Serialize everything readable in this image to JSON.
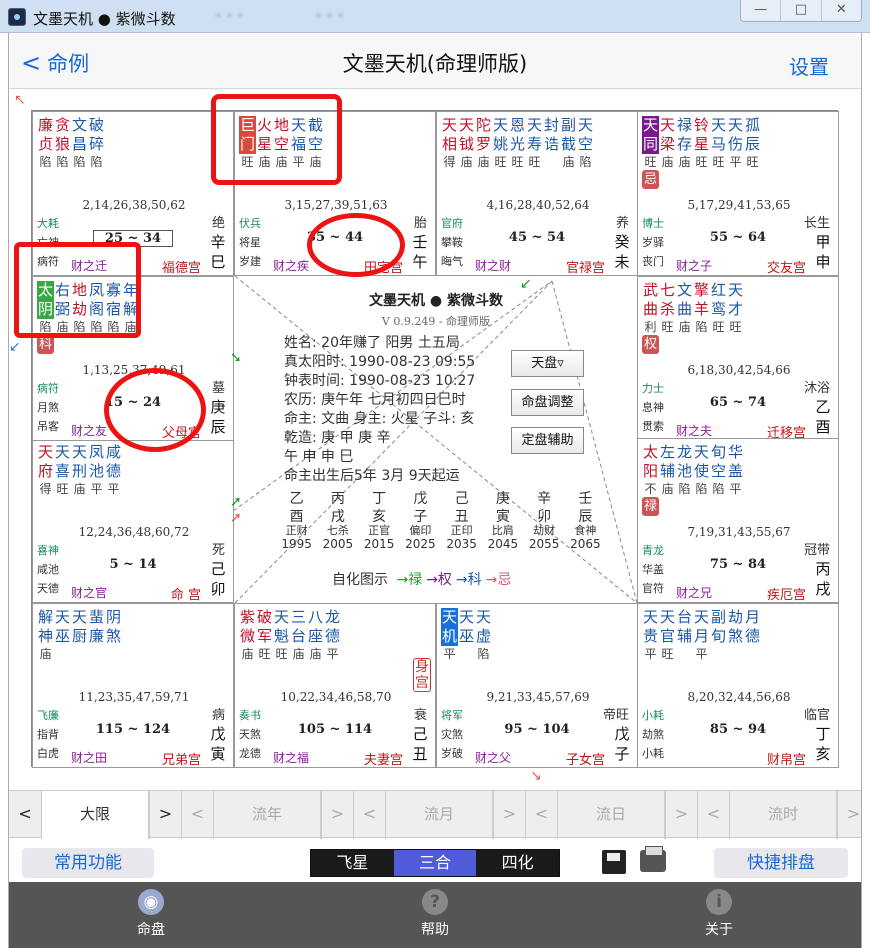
{
  "window": {
    "title": "文墨天机 ● 紫微斗数",
    "blur1": "• • •",
    "blur2": "• • •",
    "controls": [
      "—",
      "□",
      "✕"
    ]
  },
  "nav": {
    "back_label": "命例",
    "title": "文墨天机(命理师版)",
    "settings_label": "设置"
  },
  "palaces": [
    {
      "stars": [
        {
          "n": "廉贞",
          "b": "陷",
          "t": "main"
        },
        {
          "n": "贪狼",
          "b": "陷",
          "t": "main"
        },
        {
          "n": "文昌",
          "b": "陷",
          "t": "aux"
        },
        {
          "n": "破碎",
          "b": "陷",
          "t": "minor"
        }
      ],
      "ages": "2,14,26,38,50,62",
      "life": "绝",
      "range": "25 ~ 34",
      "boxed": true,
      "gz": [
        "辛",
        "巳"
      ],
      "g1": "大耗",
      "g2": "亡神",
      "g3": "病符",
      "cai": "财之迁",
      "gong": "福德宫"
    },
    {
      "stars": [
        {
          "n": "巨门",
          "b": "旺",
          "t": "chip",
          "bg": "#d94a3c"
        },
        {
          "n": "火星",
          "b": "庙",
          "t": "main"
        },
        {
          "n": "地空",
          "b": "庙",
          "t": "main"
        },
        {
          "n": "天福",
          "b": "平",
          "t": "aux"
        },
        {
          "n": "截空",
          "b": "庙",
          "t": "minor"
        }
      ],
      "ages": "3,15,27,39,51,63",
      "life": "胎",
      "range": "35 ~ 44",
      "gz": [
        "壬",
        "午"
      ],
      "g1": "伏兵",
      "g2": "将星",
      "g3": "岁建",
      "cai": "财之疾",
      "gong": "田宅宫"
    },
    {
      "stars": [
        {
          "n": "天相",
          "b": "得",
          "t": "main"
        },
        {
          "n": "天钺",
          "b": "庙",
          "t": "main"
        },
        {
          "n": "陀罗",
          "b": "庙",
          "t": "main"
        },
        {
          "n": "天姚",
          "b": "旺",
          "t": "aux"
        },
        {
          "n": "恩光",
          "b": "旺",
          "t": "aux"
        },
        {
          "n": "天寿",
          "b": "旺",
          "t": "minor"
        },
        {
          "n": "封诰",
          "b": "",
          "t": "minor"
        },
        {
          "n": "副截",
          "b": "庙",
          "t": "minor"
        },
        {
          "n": "天空",
          "b": "陷",
          "t": "minor"
        }
      ],
      "ages": "4,16,28,40,52,64",
      "life": "养",
      "range": "45 ~ 54",
      "gz": [
        "癸",
        "未"
      ],
      "g1": "官府",
      "g2": "攀鞍",
      "g3": "晦气",
      "cai": "财之财",
      "gong": "官禄宫"
    },
    {
      "stars": [
        {
          "n": "天同",
          "b": "旺",
          "t": "chip",
          "bg": "#7a1b8c"
        },
        {
          "n": "天梁",
          "b": "庙",
          "t": "main"
        },
        {
          "n": "禄存",
          "b": "庙",
          "t": "aux"
        },
        {
          "n": "铃星",
          "b": "旺",
          "t": "main"
        },
        {
          "n": "天马",
          "b": "旺",
          "t": "aux"
        },
        {
          "n": "天伤",
          "b": "平",
          "t": "minor"
        },
        {
          "n": "孤辰",
          "b": "旺",
          "t": "minor"
        }
      ],
      "hua": "忌",
      "ages": "5,17,29,41,53,65",
      "life": "长生",
      "range": "55 ~ 64",
      "gz": [
        "甲",
        "申"
      ],
      "g1": "博士",
      "g2": "岁驿",
      "g3": "丧门",
      "cai": "财之子",
      "gong": "交友宫"
    },
    {
      "stars": [
        {
          "n": "武曲",
          "b": "利",
          "t": "main"
        },
        {
          "n": "七杀",
          "b": "旺",
          "t": "main"
        },
        {
          "n": "文曲",
          "b": "庙",
          "t": "aux"
        },
        {
          "n": "擎羊",
          "b": "陷",
          "t": "main"
        },
        {
          "n": "红鸾",
          "b": "旺",
          "t": "aux"
        },
        {
          "n": "天才",
          "b": "旺",
          "t": "minor"
        }
      ],
      "hua": "权",
      "ages": "6,18,30,42,54,66",
      "life": "沐浴",
      "range": "65 ~ 74",
      "gz": [
        "乙",
        "酉"
      ],
      "g1": "力士",
      "g2": "息神",
      "g3": "贯索",
      "cai": "财之夫",
      "gong": "迁移宫"
    },
    {
      "stars": [
        {
          "n": "太阳",
          "b": "不",
          "t": "main"
        },
        {
          "n": "左辅",
          "b": "庙",
          "t": "aux"
        },
        {
          "n": "龙池",
          "b": "陷",
          "t": "minor"
        },
        {
          "n": "天使",
          "b": "陷",
          "t": "minor"
        },
        {
          "n": "旬空",
          "b": "陷",
          "t": "minor"
        },
        {
          "n": "华盖",
          "b": "平",
          "t": "minor"
        }
      ],
      "hua": "禄",
      "ages": "7,19,31,43,55,67",
      "life": "冠带",
      "range": "75 ~ 84",
      "gz": [
        "丙",
        "戌"
      ],
      "g1": "青龙",
      "g2": "华盖",
      "g3": "官符",
      "cai": "财之兄",
      "gong": "疾厄宫"
    },
    {
      "stars": [
        {
          "n": "天机",
          "b": "平",
          "t": "chip",
          "bg": "#1b6fd8"
        },
        {
          "n": "天巫",
          "b": "",
          "t": "minor"
        },
        {
          "n": "天虚",
          "b": "陷",
          "t": "minor"
        }
      ],
      "ages": "9,21,33,45,57,69",
      "life": "帝旺",
      "range": "95 ~ 104",
      "gz": [
        "戊",
        "子"
      ],
      "g1": "将军",
      "g2": "灾煞",
      "g3": "岁破",
      "cai": "财之父",
      "gong": "子女宫"
    },
    {
      "stars": [
        {
          "n": "天贵",
          "b": "平",
          "t": "minor"
        },
        {
          "n": "天官",
          "b": "旺",
          "t": "minor"
        },
        {
          "n": "台辅",
          "b": "",
          "t": "minor"
        },
        {
          "n": "天月",
          "b": "平",
          "t": "minor"
        },
        {
          "n": "副旬",
          "b": "",
          "t": "minor"
        },
        {
          "n": "劫煞",
          "b": "",
          "t": "minor"
        },
        {
          "n": "月德",
          "b": "",
          "t": "minor"
        }
      ],
      "ages": "8,20,32,44,56,68",
      "life": "临官",
      "range": "85 ~ 94",
      "gz": [
        "丁",
        "亥"
      ],
      "g1": "小耗",
      "g2": "劫煞",
      "g3": "小耗",
      "cai": "",
      "gong": "财帛宫"
    },
    {
      "stars": [
        {
          "n": "紫微",
          "b": "庙",
          "t": "main"
        },
        {
          "n": "破军",
          "b": "旺",
          "t": "main"
        },
        {
          "n": "天魁",
          "b": "旺",
          "t": "aux"
        },
        {
          "n": "三台",
          "b": "庙",
          "t": "minor"
        },
        {
          "n": "八座",
          "b": "庙",
          "t": "minor"
        },
        {
          "n": "龙德",
          "b": "平",
          "t": "minor"
        }
      ],
      "badge": "身宫",
      "ages": "10,22,34,46,58,70",
      "life": "衰",
      "range": "105 ~ 114",
      "gz": [
        "己",
        "丑"
      ],
      "g1": "奏书",
      "g2": "天煞",
      "g3": "龙德",
      "cai": "财之福",
      "gong": "夫妻宫"
    },
    {
      "stars": [
        {
          "n": "解神",
          "b": "庙",
          "t": "minor"
        },
        {
          "n": "天巫",
          "b": "",
          "t": "minor"
        },
        {
          "n": "天厨",
          "b": "",
          "t": "minor"
        },
        {
          "n": "蜚廉",
          "b": "",
          "t": "minor"
        },
        {
          "n": "阴煞",
          "b": "",
          "t": "minor"
        }
      ],
      "ages": "11,23,35,47,59,71",
      "life": "病",
      "range": "115 ~ 124",
      "gz": [
        "戊",
        "寅"
      ],
      "g1": "飞廉",
      "g2": "指背",
      "g3": "白虎",
      "cai": "财之田",
      "gong": "兄弟宫"
    },
    {
      "stars": [
        {
          "n": "天府",
          "b": "得",
          "t": "main"
        },
        {
          "n": "天喜",
          "b": "旺",
          "t": "aux"
        },
        {
          "n": "天刑",
          "b": "庙",
          "t": "minor"
        },
        {
          "n": "凤池",
          "b": "平",
          "t": "minor"
        },
        {
          "n": "咸德",
          "b": "平",
          "t": "minor"
        }
      ],
      "ages": "12,24,36,48,60,72",
      "life": "死",
      "range": "5 ~ 14",
      "gz": [
        "己",
        "卯"
      ],
      "g1": "喜神",
      "g2": "咸池",
      "g3": "天德",
      "cai": "财之官",
      "gong": "命 宫"
    },
    {
      "stars": [
        {
          "n": "太阴",
          "b": "陷",
          "t": "chip",
          "bg": "#3aa845"
        },
        {
          "n": "右弼",
          "b": "庙",
          "t": "aux"
        },
        {
          "n": "地劫",
          "b": "陷",
          "t": "main"
        },
        {
          "n": "凤阁",
          "b": "陷",
          "t": "minor"
        },
        {
          "n": "寡宿",
          "b": "陷",
          "t": "minor"
        },
        {
          "n": "年解",
          "b": "庙",
          "t": "minor"
        }
      ],
      "hua": "科",
      "ages": "1,13,25,37,49,61",
      "life": "墓",
      "range": "15 ~ 24",
      "gz": [
        "庚",
        "辰"
      ],
      "g1": "病符",
      "g2": "月煞",
      "g3": "吊客",
      "cai": "财之友",
      "gong": "父母宫"
    }
  ],
  "center": {
    "title": "文墨天机 ● 紫微斗数",
    "version": "V 0.9.249 - 命理师版",
    "lines": [
      "姓名: 20年赚了  阳男 土五局",
      "真太阳时: 1990-08-23 09:55",
      "钟表时间: 1990-08-23 10:27",
      "农历: 庚午年 七月初四日巳时",
      "命主: 文曲 身主: 火星 子斗: 亥",
      "乾造:  庚      甲      庚      辛",
      "          午      申      申      巳"
    ],
    "qiyun": "命主出生后5年 3月 9天起运",
    "dx_gan": [
      "乙",
      "丙",
      "丁",
      "戊",
      "己",
      "庚",
      "辛",
      "壬"
    ],
    "dx_zhi": [
      "酉",
      "戌",
      "亥",
      "子",
      "丑",
      "寅",
      "卯",
      "辰"
    ],
    "dx_shen": [
      "正财",
      "七杀",
      "正官",
      "偏印",
      "正印",
      "比肩",
      "劫财",
      "食神"
    ],
    "dx_year": [
      "1995",
      "2005",
      "2015",
      "2025",
      "2035",
      "2045",
      "2055",
      "2065"
    ],
    "legend_prefix": "自化图示",
    "legend": [
      {
        "t": "→禄",
        "c": "#1a9b2e"
      },
      {
        "t": "→权",
        "c": "#7a1b8c"
      },
      {
        "t": "→科",
        "c": "#1d58a8"
      },
      {
        "t": "→忌",
        "c": "#e0566c"
      }
    ],
    "buttons": [
      "天盘▿",
      "命盘调整",
      "定盘辅助"
    ]
  },
  "period_tabs": [
    {
      "label": "大限",
      "enabled": true
    },
    {
      "label": "流年",
      "enabled": false
    },
    {
      "label": "流月",
      "enabled": false
    },
    {
      "label": "流日",
      "enabled": false
    },
    {
      "label": "流时",
      "enabled": false
    }
  ],
  "period_arrows": [
    "<",
    ">"
  ],
  "toolbar": {
    "common": "常用功能",
    "modes": [
      "飞星",
      "三合",
      "四化"
    ],
    "active_mode": 1,
    "quick": "快捷排盘"
  },
  "tabbar": [
    {
      "label": "命盘",
      "icon": "chart-icon",
      "glyph": "◉",
      "active": true
    },
    {
      "label": "帮助",
      "icon": "help-icon",
      "glyph": "?",
      "active": false
    },
    {
      "label": "关于",
      "icon": "info-icon",
      "glyph": "i",
      "active": false
    }
  ],
  "colors": {
    "accent": "#1769d6",
    "highlight_ring": "#ee1313"
  }
}
